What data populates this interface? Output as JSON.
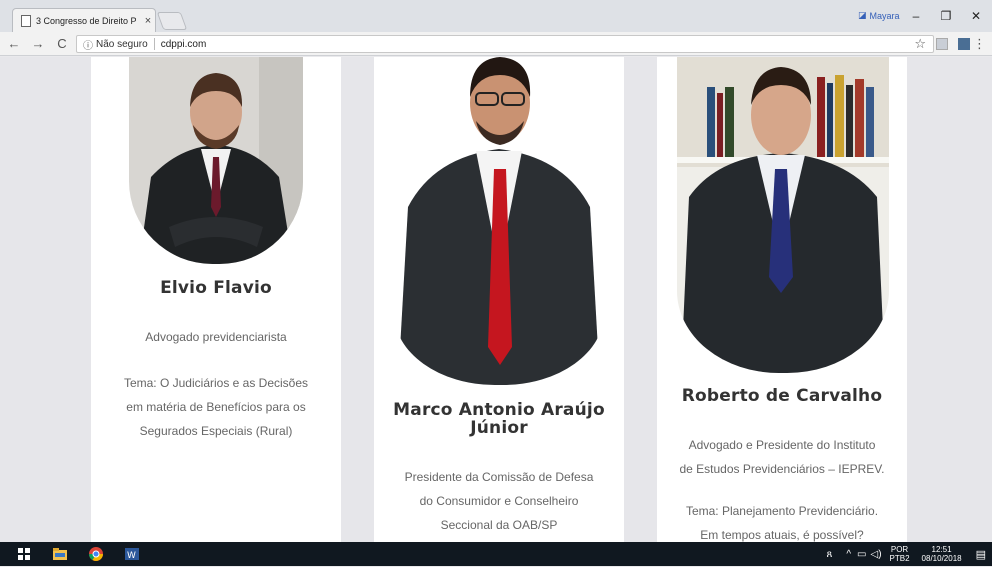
{
  "browser": {
    "tab_title": "3 Congresso de Direito P",
    "tab_close": "×",
    "profile_name": "Mayara",
    "minimize": "–",
    "restore": "❐",
    "close": "✕",
    "security_label": "Não seguro",
    "url": "cdppi.com",
    "back": "←",
    "forward": "→",
    "reload": "C",
    "bookmark": "☆",
    "menu": "⋮"
  },
  "speakers": [
    {
      "name": "Elvio Flavio",
      "role": "Advogado previdenciarista",
      "topic_line1": "Tema: O Judiciários e as Decisões",
      "topic_line2": "em matéria de Benefícios para os",
      "topic_line3": "Segurados Especiais (Rural)"
    },
    {
      "name_line1": "Marco Antonio Araújo",
      "name_line2": "Júnior",
      "role_line1": "Presidente da Comissão de Defesa",
      "role_line2": "do Consumidor e Conselheiro",
      "role_line3": "Seccional da OAB/SP"
    },
    {
      "name": "Roberto de Carvalho",
      "role_line1": "Advogado e Presidente do Instituto",
      "role_line2": "de Estudos Previdenciários – IEPREV.",
      "topic_line1": "Tema: Planejamento Previdenciário.",
      "topic_line2": "Em tempos atuais, é possível?"
    }
  ],
  "taskbar": {
    "lang": "POR",
    "layout": "PTB2",
    "time": "12:51",
    "date": "08/10/2018"
  },
  "colors": {
    "page_bg": "#e6e6ea",
    "card_bg": "#ffffff",
    "name_color": "#333333",
    "text_color": "#666666",
    "taskbar": "#101820"
  }
}
